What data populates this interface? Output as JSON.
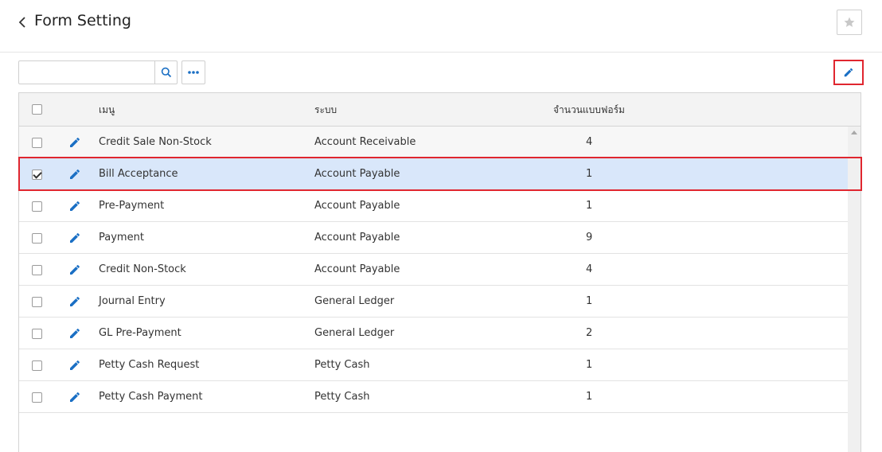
{
  "header": {
    "title": "Form Setting"
  },
  "toolbar": {
    "search_value": "",
    "search_placeholder": ""
  },
  "colors": {
    "accent": "#1a6fc4",
    "highlight": "#e0262f",
    "selected_row": "#d9e7fa"
  },
  "icons": {
    "back": "chevron-left-icon",
    "favorite": "star-icon",
    "search": "search-icon",
    "more": "ellipsis-icon",
    "edit": "pencil-icon"
  },
  "table": {
    "columns": [
      "เมนู",
      "ระบบ",
      "จำนวนแบบฟอร์ม"
    ],
    "rows": [
      {
        "menu": "Credit Sale Non-Stock",
        "system": "Account Receivable",
        "count": "4",
        "checked": false
      },
      {
        "menu": "Bill Acceptance",
        "system": "Account Payable",
        "count": "1",
        "checked": true
      },
      {
        "menu": "Pre-Payment",
        "system": "Account Payable",
        "count": "1",
        "checked": false
      },
      {
        "menu": "Payment",
        "system": "Account Payable",
        "count": "9",
        "checked": false
      },
      {
        "menu": "Credit Non-Stock",
        "system": "Account Payable",
        "count": "4",
        "checked": false
      },
      {
        "menu": "Journal Entry",
        "system": "General Ledger",
        "count": "1",
        "checked": false
      },
      {
        "menu": "GL Pre-Payment",
        "system": "General Ledger",
        "count": "2",
        "checked": false
      },
      {
        "menu": "Petty Cash Request",
        "system": "Petty Cash",
        "count": "1",
        "checked": false
      },
      {
        "menu": "Petty Cash Payment",
        "system": "Petty Cash",
        "count": "1",
        "checked": false
      }
    ]
  }
}
